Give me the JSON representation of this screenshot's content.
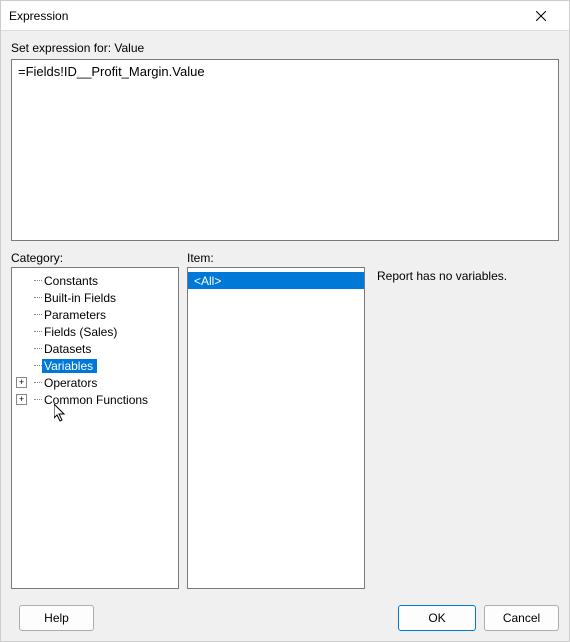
{
  "window": {
    "title": "Expression"
  },
  "prompt": "Set expression for: Value",
  "expression": "=Fields!ID__Profit_Margin.Value",
  "labels": {
    "category": "Category:",
    "item": "Item:"
  },
  "category_tree": [
    {
      "label": "Constants",
      "expandable": false
    },
    {
      "label": "Built-in Fields",
      "expandable": false
    },
    {
      "label": "Parameters",
      "expandable": false
    },
    {
      "label": "Fields (Sales)",
      "expandable": false
    },
    {
      "label": "Datasets",
      "expandable": false
    },
    {
      "label": "Variables",
      "expandable": false,
      "selected": true
    },
    {
      "label": "Operators",
      "expandable": true
    },
    {
      "label": "Common Functions",
      "expandable": true
    }
  ],
  "items": [
    {
      "label": "<All>",
      "selected": true
    }
  ],
  "description": "Report has no variables.",
  "buttons": {
    "help": "Help",
    "ok": "OK",
    "cancel": "Cancel"
  }
}
